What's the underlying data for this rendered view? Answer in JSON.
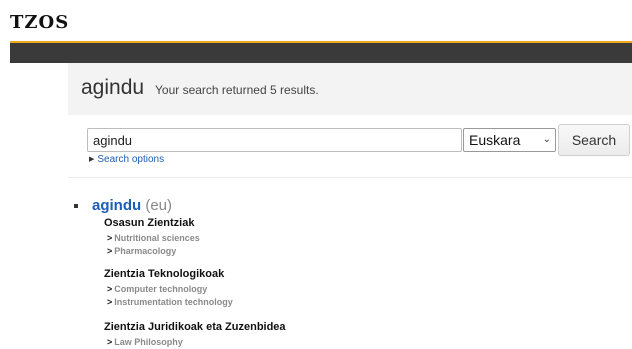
{
  "site": {
    "logo": "TZOS"
  },
  "results": {
    "term": "agindu",
    "summary": "Your search returned 5 results."
  },
  "search": {
    "value": "agindu",
    "language": "Euskara",
    "button": "Search",
    "options_link": "Search options"
  },
  "entries": [
    {
      "headword": "agindu",
      "lang_code": "(eu)",
      "domains": [
        {
          "name": "Osasun Zientziak",
          "subdomains": [
            "Nutritional sciences",
            "Pharmacology"
          ]
        },
        {
          "name": "Zientzia Teknologikoak",
          "subdomains": [
            "Computer technology",
            "Instrumentation technology"
          ]
        },
        {
          "name": "Zientzia Juridikoak eta Zuzenbidea",
          "subdomains": [
            "Law Philosophy"
          ]
        }
      ]
    }
  ],
  "colors": {
    "accent": "#f0a81c",
    "bar": "#3a3a3a",
    "link": "#1a5fb4"
  }
}
